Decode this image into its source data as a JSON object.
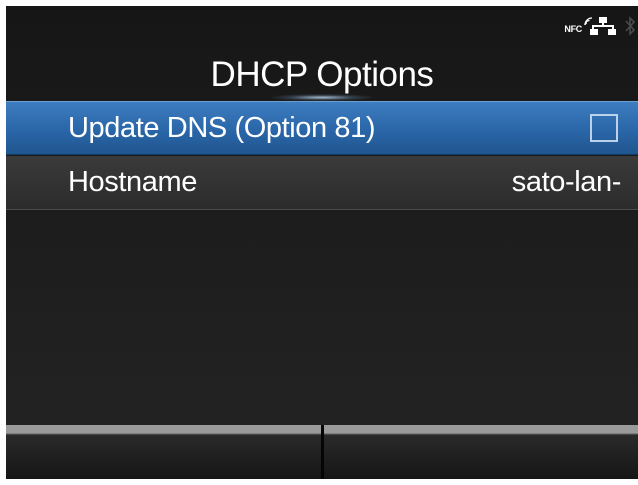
{
  "header": {
    "title": "DHCP Options",
    "status_icons": {
      "nfc_label": "NFC",
      "network_icon": "network-icon",
      "bluetooth_icon": "bluetooth-icon"
    }
  },
  "menu": {
    "items": [
      {
        "label": "Update DNS (Option 81)",
        "control": "checkbox",
        "checked": false,
        "selected": true
      },
      {
        "label": "Hostname",
        "value": "sato-lan-",
        "selected": false
      }
    ]
  },
  "softkeys": [
    {
      "label": ""
    },
    {
      "label": ""
    }
  ],
  "colors": {
    "background": "#1c1c1c",
    "selected_row": "#2a66a8",
    "text": "#ffffff",
    "softkey_bar": "#9a9a9a"
  }
}
